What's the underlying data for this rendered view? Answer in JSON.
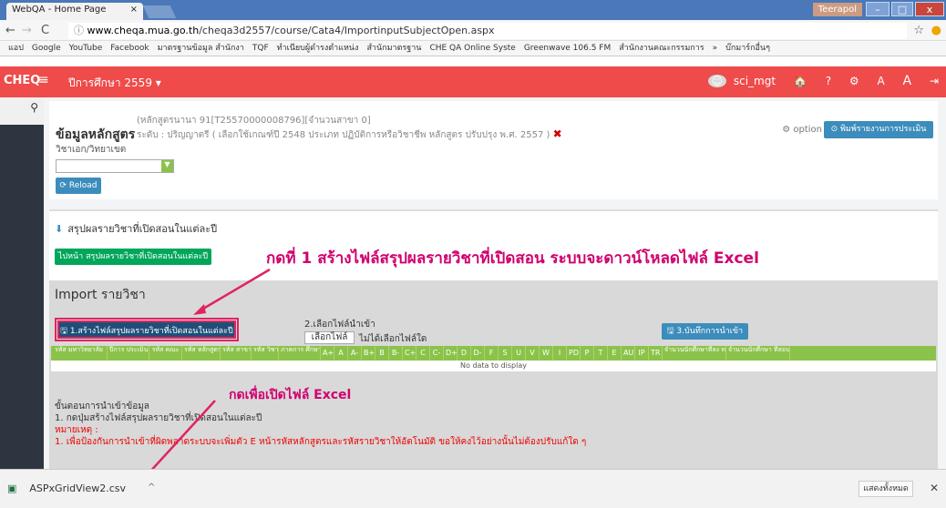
{
  "browser": {
    "tab_title": "WebQA - Home Page",
    "tab_close": "×",
    "window_user": "Teerapol",
    "min": "–",
    "max": "□",
    "close": "x",
    "back": "←",
    "forward": "→",
    "reload": "C",
    "url_host": "www.cheqa.mua.go.th",
    "url_path": "/cheqa3d2557/course/Cata4/ImportinputSubjectOpen.aspx",
    "star": "☆",
    "bookmarks": [
      "แอป",
      "Google",
      "YouTube",
      "Facebook",
      "มาตรฐานข้อมูล สำนักงา",
      "TQF",
      "ทำเนียบผู้ดำรงตำแหน่ง",
      "สำนักมาตรฐาน",
      "CHE QA Online Syste",
      "Greenwave 106.5 FM",
      "สำนักงานคณะกรรมการ",
      "»",
      "บ๊กมาร์กอื่นๆ"
    ]
  },
  "topnav": {
    "brand": "CHEQ",
    "menu": "≡",
    "year": "ปีการศึกษา 2559 ▾",
    "user": "sci_mgt",
    "icons": [
      "🏠",
      "?",
      "⚙",
      "A",
      "A",
      "⇥"
    ]
  },
  "page": {
    "title": "ข้อมูลหลักสูตร",
    "subtitle1": "(หลักสูตรนานา 91[T25570000008796][จำนวนสาขา 0]",
    "subtitle2": "ระดับ : ปริญญาตรี ( เลือกใช้เกณฑ์ปี 2548 ประเภท ปฏิบัติการหรือวิชาชีพ หลักสูตร ปรับปรุง พ.ศ. 2557 )",
    "subtitle2_x": "✖",
    "title2": "วิชาเอก/วิทยาเขต",
    "select_value": "",
    "reload_label": "⟳ Reload",
    "option_label": "⚙ option",
    "print_label": "⊙ พิมพ์รายงานการประเมินตนเอง"
  },
  "section": {
    "header": "สรุปผลรายวิชาที่เปิดสอนในแต่ละปี",
    "header_icon": "⬇",
    "goto_button": "ไปหน้า สรุปผลรายวิชาที่เปิดสอนในแต่ละปี",
    "annotation1": "กดที่ 1 สร้างไฟล์สรุปผลรายวิชาที่เปิดสอน ระบบจะดาวน์โหลดไฟล์ Excel",
    "annotation2": "กดเพื่อเปิดไฟล์ Excel",
    "import_title_1": "Import ",
    "import_title_2": "รายวิชา",
    "create_button": "🖫 1.สร้างไฟล์สรุปผลรายวิชาที่เปิดสอนในแต่ละปี",
    "step2_label": "2.เลือกไฟล์นำเข้า",
    "choose_file": "เลือกไฟล์",
    "no_file": "ไม่ได้เลือกไฟล์ใด",
    "save_button": "🖫 3.บันทึกการนำเข้า",
    "columns": [
      "รหัส มหาวิทยาลัย",
      "ปีการ ประเมิน",
      "รหัส คณะ",
      "รหัส หลักสูตร",
      "รหัส สาขา",
      "รหัส วิชา",
      "ภาคการ ศึกษาที่",
      "A+",
      "A",
      "A-",
      "B+",
      "B",
      "B-",
      "C+",
      "C",
      "C-",
      "D+",
      "D",
      "D-",
      "F",
      "S",
      "U",
      "V",
      "W",
      "I",
      "PD",
      "P",
      "T",
      "E",
      "AU",
      "IP",
      "TR",
      "จำนวนนักศึกษาที่ลง ทะเบียนเรียน",
      "จำนวนนักศึกษา ที่สอบผ่าน"
    ],
    "no_data": "No data to display",
    "steps_title": "ขั้นตอนการนำเข้าข้อมูล",
    "step1": "1. กดปุ่มสร้างไฟล์สรุปผลรายวิชาที่เปิดสอนในแต่ละปี",
    "note_title": "หมายเหตุ :",
    "note1": "1. เพื่อป้องกันการนำเข้าที่ผิดพลาดระบบจะเพิ่มตัว E หน้ารหัสหลักสูตรและรหัสรายวิชาให้อัตโนมัติ ขอให้คงไว้อย่างนั้นไม่ต้องปรับแก้ใด ๆ"
  },
  "download": {
    "file": "ASPxGridView2.csv",
    "chevron": "^",
    "show_all": "แสดงทั้งหมด",
    "close": "✕"
  }
}
